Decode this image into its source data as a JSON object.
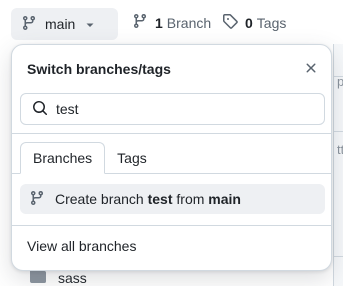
{
  "header": {
    "branch_button_label": "main",
    "branch_count": "1",
    "branch_word": "Branch",
    "tag_count": "0",
    "tag_word": "Tags"
  },
  "popover": {
    "title": "Switch branches/tags",
    "search": {
      "value": "test",
      "placeholder": ""
    },
    "tabs": [
      {
        "label": "Branches",
        "active": true
      },
      {
        "label": "Tags",
        "active": false
      }
    ],
    "create": {
      "prefix": "Create branch ",
      "branch": "test",
      "middle": " from ",
      "source": "main"
    },
    "view_all_label": "View all branches"
  },
  "background": {
    "file_item": "sass",
    "right_fragments": [
      "po",
      "tth"
    ]
  },
  "icons": {
    "branch": "git-branch-icon",
    "tag": "tag-icon",
    "caret": "triangle-down-icon",
    "close": "x-icon",
    "search": "search-icon",
    "folder": "folder-icon"
  },
  "colors": {
    "text": "#1f2328",
    "muted": "#59636e",
    "border": "#d1d9e0",
    "button_bg": "#eef0f3",
    "folder": "#8c959f"
  }
}
